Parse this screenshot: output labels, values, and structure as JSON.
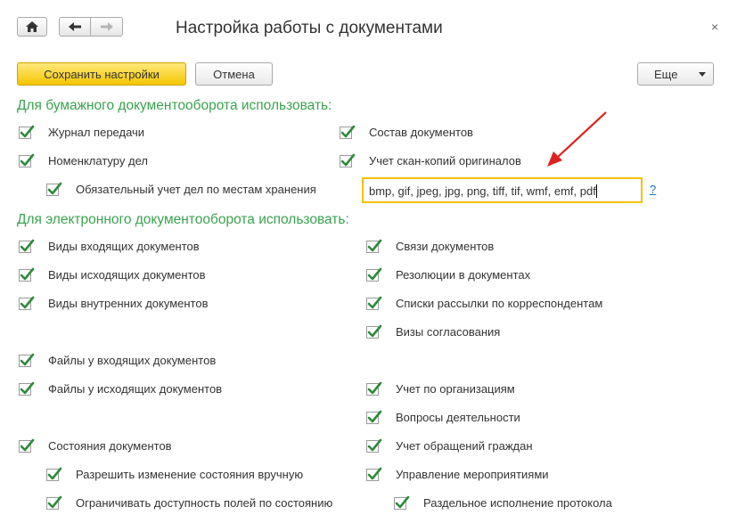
{
  "window": {
    "title": "Настройка работы с документами",
    "close_glyph": "×"
  },
  "toolbar": {
    "save_label": "Сохранить настройки",
    "cancel_label": "Отмена",
    "more_label": "Еще"
  },
  "paper": {
    "heading": "Для бумажного документооборота использовать:",
    "items": [
      {
        "label": "Журнал передачи",
        "checked": true
      },
      {
        "label": "Номенклатуру дел",
        "checked": true
      },
      {
        "label": "Обязательный учет дел по местам хранения",
        "checked": true
      },
      {
        "label": "Состав документов",
        "checked": true
      },
      {
        "label": "Учет скан-копий оригиналов",
        "checked": true
      }
    ],
    "extensions_value": "bmp, gif, jpeg, jpg, png, tiff, tif, wmf, emf, pdf",
    "help_glyph": "?"
  },
  "electronic": {
    "heading": "Для электронного документооборота использовать:",
    "items": [
      {
        "label": "Виды входящих документов",
        "checked": true
      },
      {
        "label": "Виды исходящих документов",
        "checked": true
      },
      {
        "label": "Виды внутренних документов",
        "checked": true
      },
      {
        "label": "Файлы у входящих документов",
        "checked": true
      },
      {
        "label": "Файлы у исходящих документов",
        "checked": true
      },
      {
        "label": "Состояния документов",
        "checked": true
      },
      {
        "label": "Разрешить изменение состояния вручную",
        "checked": true
      },
      {
        "label": "Ограничивать доступность полей по состоянию",
        "checked": true
      },
      {
        "label": "Связи документов",
        "checked": true
      },
      {
        "label": "Резолюции в документах",
        "checked": true
      },
      {
        "label": "Списки рассылки по корреспондентам",
        "checked": true
      },
      {
        "label": "Визы согласования",
        "checked": true
      },
      {
        "label": "Учет по организациям",
        "checked": true
      },
      {
        "label": "Вопросы деятельности",
        "checked": true
      },
      {
        "label": "Учет обращений граждан",
        "checked": true
      },
      {
        "label": "Управление мероприятиями",
        "checked": true
      },
      {
        "label": "Раздельное исполнение протокола",
        "checked": true
      }
    ]
  },
  "colors": {
    "section_heading": "#3aa34e",
    "checkmark": "#2e8b3a",
    "primary_button": "#f5c500",
    "input_focus_border": "#f2c200",
    "annotation_arrow": "#e02020"
  }
}
